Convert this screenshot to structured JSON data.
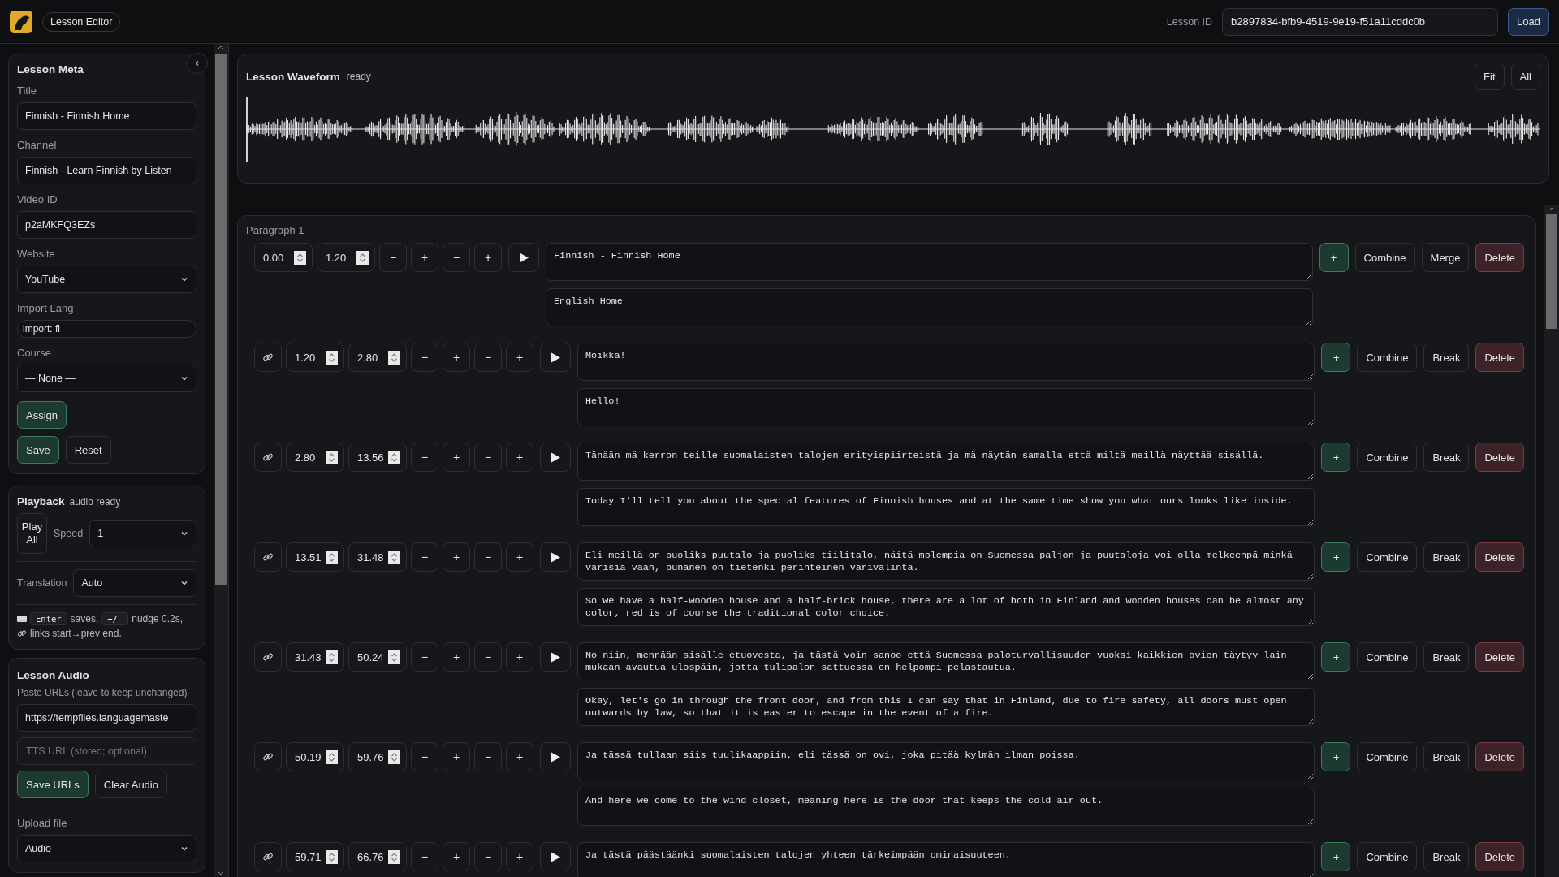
{
  "header": {
    "badge": "Lesson Editor",
    "lesson_id_label": "Lesson ID",
    "lesson_id": "b2897834-bfb9-4519-9e19-f51a11cddc0b",
    "load_button": "Load"
  },
  "sidebar": {
    "meta": {
      "title": "Lesson Meta",
      "fields": [
        {
          "label": "Title",
          "value": "Finnish - Finnish Home",
          "kind": "text"
        },
        {
          "label": "Channel",
          "value": "Finnish - Learn Finnish by Listen",
          "kind": "text"
        },
        {
          "label": "Video ID",
          "value": "p2aMKFQ3EZs",
          "kind": "text"
        },
        {
          "label": "Website",
          "value": "YouTube",
          "kind": "select"
        },
        {
          "label": "Import Lang",
          "value": "import: fi",
          "kind": "compact"
        },
        {
          "label": "Course",
          "value": "— None —",
          "kind": "select"
        }
      ],
      "assign_button": "Assign",
      "save_button": "Save",
      "reset_button": "Reset"
    },
    "playback": {
      "title": "Playback",
      "status": "audio ready",
      "play_all": "Play All",
      "speed_label": "Speed",
      "speed": "1",
      "translation_label": "Translation",
      "translation": "Auto",
      "hint": {
        "key1": "Enter",
        "text1": "saves,",
        "key2": "+/-",
        "text2": "nudge 0.2s,",
        "text3": "links start→prev end."
      }
    },
    "audio": {
      "title": "Lesson Audio",
      "hint": "Paste URLs (leave to keep unchanged)",
      "url": "https://tempfiles.languagemaste",
      "tts_placeholder": "TTS URL (stored; optional)",
      "save_button": "Save URLs",
      "clear_button": "Clear Audio",
      "upload_label": "Upload file",
      "upload_type": "Audio"
    }
  },
  "waveform": {
    "title": "Lesson Waveform",
    "status": "ready",
    "buttons": [
      "Fit",
      "All"
    ]
  },
  "paragraphs": [
    {
      "title": "Paragraph 1",
      "segments": [
        {
          "linked": false,
          "start": "0.00",
          "end": "1.20",
          "nudges": [
            "−",
            "+",
            "−",
            "+"
          ],
          "text": "Finnish - Finnish Home",
          "translation": "English Home",
          "actions": [
            {
              "kind": "add",
              "label": "+"
            },
            {
              "kind": "plain",
              "label": "Combine"
            },
            {
              "kind": "plain",
              "label": "Merge"
            },
            {
              "kind": "danger",
              "label": "Delete"
            }
          ]
        },
        {
          "linked": true,
          "start": "1.20",
          "end": "2.80",
          "nudges": [
            "−",
            "+",
            "−",
            "+"
          ],
          "text": "Moikka!",
          "translation": "Hello!",
          "actions": [
            {
              "kind": "add",
              "label": "+"
            },
            {
              "kind": "plain",
              "label": "Combine"
            },
            {
              "kind": "plain",
              "label": "Break"
            },
            {
              "kind": "danger",
              "label": "Delete"
            }
          ]
        },
        {
          "linked": true,
          "start": "2.80",
          "end": "13.56",
          "nudges": [
            "−",
            "+",
            "−",
            "+"
          ],
          "text": "Tänään mä kerron teille suomalaisten talojen erityispiirteistä ja mä näytän samalla että miltä meillä näyttää sisällä.",
          "translation": "Today I'll tell you about the special features of Finnish houses and at the same time show you what ours looks like inside.",
          "actions": [
            {
              "kind": "add",
              "label": "+"
            },
            {
              "kind": "plain",
              "label": "Combine"
            },
            {
              "kind": "plain",
              "label": "Break"
            },
            {
              "kind": "danger",
              "label": "Delete"
            }
          ]
        },
        {
          "linked": true,
          "start": "13.51",
          "end": "31.48",
          "nudges": [
            "−",
            "+",
            "−",
            "+"
          ],
          "text": "Eli meillä on puoliks puutalo ja puoliks tiilitalo, näitä molempia on Suomessa paljon ja puutaloja voi olla melkeenpä minkä värisiä vaan, punanen on tietenki perinteinen värivalinta.",
          "translation": "So we have a half-wooden house and a half-brick house, there are a lot of both in Finland and wooden houses can be almost any color, red is of course the traditional color choice.",
          "actions": [
            {
              "kind": "add",
              "label": "+"
            },
            {
              "kind": "plain",
              "label": "Combine"
            },
            {
              "kind": "plain",
              "label": "Break"
            },
            {
              "kind": "danger",
              "label": "Delete"
            }
          ]
        },
        {
          "linked": true,
          "start": "31.43",
          "end": "50.24",
          "nudges": [
            "−",
            "+",
            "−",
            "+"
          ],
          "text": "No niin, mennään sisälle etuovesta, ja tästä voin sanoo että Suomessa paloturvallisuuden vuoksi kaikkien ovien täytyy lain mukaan avautua ulospäin, jotta tulipalon sattuessa on helpompi pelastautua.",
          "translation": "Okay, let's go in through the front door, and from this I can say that in Finland, due to fire safety, all doors must open outwards by law, so that it is easier to escape in the event of a fire.",
          "actions": [
            {
              "kind": "add",
              "label": "+"
            },
            {
              "kind": "plain",
              "label": "Combine"
            },
            {
              "kind": "plain",
              "label": "Break"
            },
            {
              "kind": "danger",
              "label": "Delete"
            }
          ]
        },
        {
          "linked": true,
          "start": "50.19",
          "end": "59.76",
          "nudges": [
            "−",
            "+",
            "−",
            "+"
          ],
          "text": "Ja tässä tullaan siis tuulikaappiin, eli tässä on ovi, joka pitää kylmän ilman poissa.",
          "translation": "And here we come to the wind closet, meaning here is the door that keeps the cold air out.",
          "actions": [
            {
              "kind": "add",
              "label": "+"
            },
            {
              "kind": "plain",
              "label": "Combine"
            },
            {
              "kind": "plain",
              "label": "Break"
            },
            {
              "kind": "danger",
              "label": "Delete"
            }
          ]
        },
        {
          "linked": true,
          "start": "59.71",
          "end": "66.76",
          "nudges": [
            "−",
            "+",
            "−",
            "+"
          ],
          "text": "Ja tästä päästäänki suomalaisten talojen yhteen tärkeimpään ominaisuuteen.",
          "actions": [
            {
              "kind": "add",
              "label": "+"
            },
            {
              "kind": "plain",
              "label": "Combine"
            },
            {
              "kind": "plain",
              "label": "Break"
            },
            {
              "kind": "danger",
              "label": "Delete"
            }
          ]
        }
      ]
    }
  ]
}
